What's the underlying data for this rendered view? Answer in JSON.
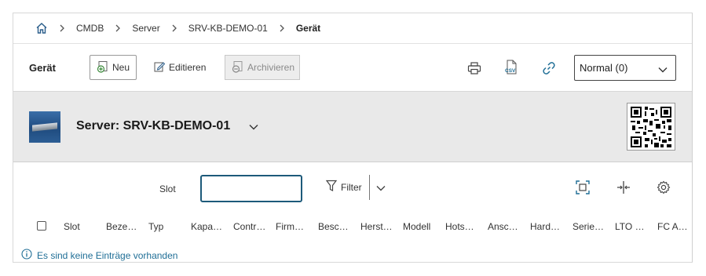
{
  "breadcrumb": {
    "items": [
      "CMDB",
      "Server",
      "SRV-KB-DEMO-01"
    ],
    "current": "Gerät"
  },
  "toolbar": {
    "title": "Gerät",
    "new_label": "Neu",
    "edit_label": "Editieren",
    "archive_label": "Archivieren",
    "view_select": "Normal (0)"
  },
  "object": {
    "title": "Server: SRV-KB-DEMO-01"
  },
  "filter": {
    "label": "Slot",
    "input_value": "",
    "filter_label": "Filter"
  },
  "table": {
    "columns": [
      "Slot",
      "Beze…",
      "Typ",
      "Kapa…",
      "Contr…",
      "Firm…",
      "Besc…",
      "Herst…",
      "Modell",
      "Hots…",
      "Ansc…",
      "Hard…",
      "Serie…",
      "LTO …",
      "FC A…"
    ],
    "empty_message": "Es sind keine Einträge vorhanden"
  },
  "colors": {
    "accent": "#1f6e96",
    "input_border": "#1d5a7a",
    "header_bg": "#e9e9e9"
  },
  "icons": [
    "home-icon",
    "add-icon",
    "edit-icon",
    "archive-icon",
    "print-icon",
    "csv-icon",
    "link-icon",
    "qr-code-icon",
    "filter-icon",
    "fullscreen-icon",
    "column-resize-icon",
    "settings-icon",
    "info-icon"
  ]
}
